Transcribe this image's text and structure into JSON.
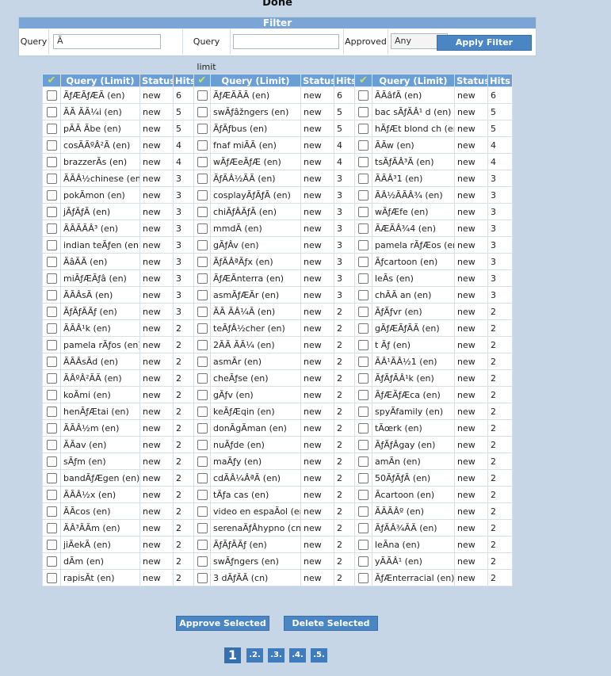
{
  "page": {
    "status": "Done"
  },
  "filter": {
    "title": "Filter",
    "query_label": "Query",
    "query_value": "Ã",
    "limit_label": "Query limit",
    "limit_value": "",
    "approved_label": "Approved",
    "approved_value": "Any",
    "apply_label": "Apply Filter"
  },
  "table": {
    "headers": {
      "query": "Query (Limit)",
      "status": "Status",
      "hits": "Hits"
    },
    "rows": [
      [
        [
          "ÃƒÆÃƒÆÃ (en)",
          "new",
          "6"
        ],
        [
          "ÃƒÆÃÃÃ (en)",
          "new",
          "6"
        ],
        [
          "ÃÃâfÃ (en)",
          "new",
          "6"
        ]
      ],
      [
        [
          "ÃÃ ÃÃ¼i (en)",
          "new",
          "5"
        ],
        [
          "swÃƒâžngers (en)",
          "new",
          "5"
        ],
        [
          "bac sÃƒÃÂ¹ d (en)",
          "new",
          "5"
        ]
      ],
      [
        [
          "pÃÃ Ãbe (en)",
          "new",
          "5"
        ],
        [
          "ÃƒÃƒbus (en)",
          "new",
          "5"
        ],
        [
          "hÃƒÆt blond ch (en)",
          "new",
          "5"
        ]
      ],
      [
        [
          "cosÃÃºÂ²Ã (en)",
          "new",
          "4"
        ],
        [
          "fnaf miÃÃ  (en)",
          "new",
          "4"
        ],
        [
          "ÃÃw (en)",
          "new",
          "4"
        ]
      ],
      [
        [
          "brazzerÃs (en)",
          "new",
          "4"
        ],
        [
          "wÃƒÆeÃƒÆ (en)",
          "new",
          "4"
        ],
        [
          "tsÃƒÃÂ³Ã (en)",
          "new",
          "4"
        ]
      ],
      [
        [
          "ÃÃÂ½chinese (en)",
          "new",
          "3"
        ],
        [
          "ÃƒÃÂ½ÃÃ (en)",
          "new",
          "3"
        ],
        [
          "ÃÃÂ³1 (en)",
          "new",
          "3"
        ]
      ],
      [
        [
          "pokÃmon (en)",
          "new",
          "3"
        ],
        [
          "cosplayÃƒÃƒÃ (en)",
          "new",
          "3"
        ],
        [
          "ÃÂ½ÃÃÂ¾ (en)",
          "new",
          "3"
        ]
      ],
      [
        [
          "jÃƒÃƒÃ (en)",
          "new",
          "3"
        ],
        [
          "chiÃƒÂÃƒÃ (en)",
          "new",
          "3"
        ],
        [
          "wÃƒÆfe (en)",
          "new",
          "3"
        ]
      ],
      [
        [
          "ÃÃÃÃÂ³ (en)",
          "new",
          "3"
        ],
        [
          "mmdÃ (en)",
          "new",
          "3"
        ],
        [
          "ÃÆÃÂ¾4 (en)",
          "new",
          "3"
        ]
      ],
      [
        [
          "indian teÃƒen (en)",
          "new",
          "3"
        ],
        [
          "gÃƒÂv (en)",
          "new",
          "3"
        ],
        [
          "pamela rÃƒÆos (en)",
          "new",
          "3"
        ]
      ],
      [
        [
          "ÃâÃÃ (en)",
          "new",
          "3"
        ],
        [
          "ÃƒÃÂªÃƒx (en)",
          "new",
          "3"
        ],
        [
          "Ãƒcartoon (en)",
          "new",
          "3"
        ]
      ],
      [
        [
          "miÃƒÆÃƒâ (en)",
          "new",
          "3"
        ],
        [
          "ÃƒÆÃnterra (en)",
          "new",
          "3"
        ],
        [
          "leÃs (en)",
          "new",
          "3"
        ]
      ],
      [
        [
          "ÃÃÂsÃ (en)",
          "new",
          "3"
        ],
        [
          "asmÃƒÆÃr (en)",
          "new",
          "3"
        ],
        [
          "chÃÃ an (en)",
          "new",
          "3"
        ]
      ],
      [
        [
          "ÃƒÃƒÃÃƒ (en)",
          "new",
          "3"
        ],
        [
          "ÃÃ ÃÂ¼Ã (en)",
          "new",
          "2"
        ],
        [
          "ÃƒÃƒvr (en)",
          "new",
          "2"
        ]
      ],
      [
        [
          "ÃÃÂ¹k (en)",
          "new",
          "2"
        ],
        [
          "teÃƒÂ½cher (en)",
          "new",
          "2"
        ],
        [
          "gÃƒÆÃƒÃÃ (en)",
          "new",
          "2"
        ]
      ],
      [
        [
          "pamela rÃƒos (en)",
          "new",
          "2"
        ],
        [
          "2ÃÃ ÃÃ¼ (en)",
          "new",
          "2"
        ],
        [
          "t Ãƒ (en)",
          "new",
          "2"
        ]
      ],
      [
        [
          "ÃÃÂsÃd (en)",
          "new",
          "2"
        ],
        [
          "asmÃr (en)",
          "new",
          "2"
        ],
        [
          "ÃÂ¹ÃÂ½1 (en)",
          "new",
          "2"
        ]
      ],
      [
        [
          "ÃÂºÂ²ÃÃ (en)",
          "new",
          "2"
        ],
        [
          "cheÃƒse (en)",
          "new",
          "2"
        ],
        [
          "ÃƒÃƒÃÂ¹k (en)",
          "new",
          "2"
        ]
      ],
      [
        [
          "koÃmi (en)",
          "new",
          "2"
        ],
        [
          "gÃƒv (en)",
          "new",
          "2"
        ],
        [
          "ÃƒÆÃƒÆca (en)",
          "new",
          "2"
        ]
      ],
      [
        [
          "henÃƒÆtai (en)",
          "new",
          "2"
        ],
        [
          "keÃƒÆqin (en)",
          "new",
          "2"
        ],
        [
          "spyÃfamily (en)",
          "new",
          "2"
        ]
      ],
      [
        [
          "ÃÃÂ½m (en)",
          "new",
          "2"
        ],
        [
          "donÃgÃman (en)",
          "new",
          "2"
        ],
        [
          "tÃœrk (en)",
          "new",
          "2"
        ]
      ],
      [
        [
          "ÃÃav (en)",
          "new",
          "2"
        ],
        [
          "nuÃƒde (en)",
          "new",
          "2"
        ],
        [
          "ÃƒÃƒÂgay (en)",
          "new",
          "2"
        ]
      ],
      [
        [
          "sÃƒm (en)",
          "new",
          "2"
        ],
        [
          "maÃƒy (en)",
          "new",
          "2"
        ],
        [
          "amÃn (en)",
          "new",
          "2"
        ]
      ],
      [
        [
          "bandÃƒÆgen (en)",
          "new",
          "2"
        ],
        [
          "cdÃÂ¼ÂªÃ (en)",
          "new",
          "2"
        ],
        [
          "50ÃƒÃƒÃ (en)",
          "new",
          "2"
        ]
      ],
      [
        [
          "ÃÃÂ½x (en)",
          "new",
          "2"
        ],
        [
          "tÃƒa cas (en)",
          "new",
          "2"
        ],
        [
          "Ãcartoon (en)",
          "new",
          "2"
        ]
      ],
      [
        [
          "ÃÃcos (en)",
          "new",
          "2"
        ],
        [
          "video en espaÃol (en)",
          "new",
          "2"
        ],
        [
          "ÃÃÃÂº (en)",
          "new",
          "2"
        ]
      ],
      [
        [
          "ÃÂ³ÃÃm (en)",
          "new",
          "2"
        ],
        [
          "serenaÃƒÂhypno (cn)",
          "new",
          "2"
        ],
        [
          "ÃƒÃÂ¾ÃÃ (en)",
          "new",
          "2"
        ]
      ],
      [
        [
          "jiÃekÃ (en)",
          "new",
          "2"
        ],
        [
          "ÃƒÃƒÃÃƒ (en)",
          "new",
          "2"
        ],
        [
          "leÃna (en)",
          "new",
          "2"
        ]
      ],
      [
        [
          "dÃm (en)",
          "new",
          "2"
        ],
        [
          "swÃƒngers (en)",
          "new",
          "2"
        ],
        [
          "yÃÃÂ¹ (en)",
          "new",
          "2"
        ]
      ],
      [
        [
          "rapisÃt (en)",
          "new",
          "2"
        ],
        [
          "3 dÃƒÃÃ  (cn)",
          "new",
          "2"
        ],
        [
          "ÃƒÆnterracial (en)",
          "new",
          "2"
        ]
      ]
    ]
  },
  "actions": {
    "approve_label": "Approve Selected",
    "delete_label": "Delete Selected"
  },
  "pager": {
    "pages": [
      "1",
      ".2.",
      ".3.",
      ".4.",
      ".5."
    ]
  }
}
